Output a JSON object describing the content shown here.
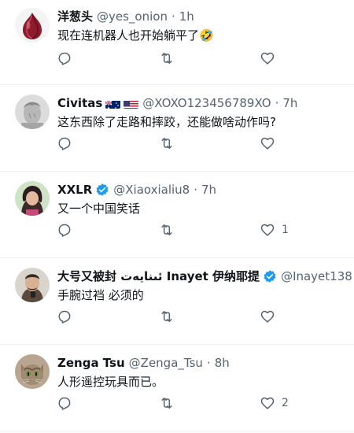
{
  "tweets": [
    {
      "name": "洋葱头",
      "handle": "@yes_onion",
      "time": "1h",
      "text": "现在连机器人也开始躺平了🤣",
      "likes": "",
      "avatar": "onion",
      "verified": false,
      "flags": []
    },
    {
      "name": "Civitas",
      "handle": "@XOXO123456789XO",
      "time": "7h",
      "text": "这东西除了走路和摔跤，还能做啥动作吗?",
      "likes": "",
      "avatar": "statue",
      "verified": false,
      "flags": [
        "au-flag",
        "us-flag"
      ]
    },
    {
      "name": "XXLR",
      "handle": "@Xiaoxialiu8",
      "time": "7h",
      "text": "又一个中国笑话",
      "likes": "1",
      "avatar": "woman",
      "verified": true,
      "flags": []
    },
    {
      "name": "大号又被封 ئىنايەت Inayet 伊纳耶提",
      "handle": "@Inayet138",
      "time": "",
      "text": "手腕过裆 必须的",
      "likes": "",
      "avatar": "man",
      "verified": true,
      "flags": []
    },
    {
      "name": "Zenga Tsu",
      "handle": "@Zenga_Tsu",
      "time": "8h",
      "text": "人形遥控玩具而已。",
      "likes": "2",
      "avatar": "cat",
      "verified": false,
      "flags": []
    }
  ],
  "dot": "·",
  "icons": {
    "reply": "reply-icon",
    "retweet": "retweet-icon",
    "like": "heart-icon",
    "verified": "verified-badge-icon"
  },
  "colors": {
    "verified": "#1d9bf0",
    "muted": "#536471",
    "border": "#eff3f4"
  }
}
